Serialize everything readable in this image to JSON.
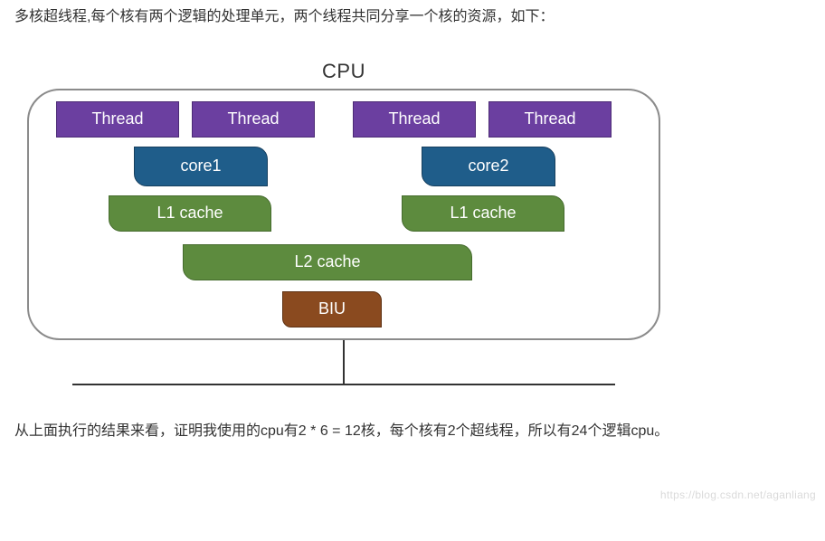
{
  "intro": "多核超线程,每个核有两个逻辑的处理单元，两个线程共同分享一个核的资源，如下：",
  "diagram": {
    "title": "CPU",
    "threads": [
      "Thread",
      "Thread",
      "Thread",
      "Thread"
    ],
    "cores": [
      "core1",
      "core2"
    ],
    "l1": [
      "L1 cache",
      "L1 cache"
    ],
    "l2": "L2 cache",
    "biu": "BIU"
  },
  "outro": "从上面执行的结果来看，证明我使用的cpu有2 * 6 = 12核，每个核有2个超线程，所以有24个逻辑cpu。",
  "watermark": "https://blog.csdn.net/aganliang"
}
